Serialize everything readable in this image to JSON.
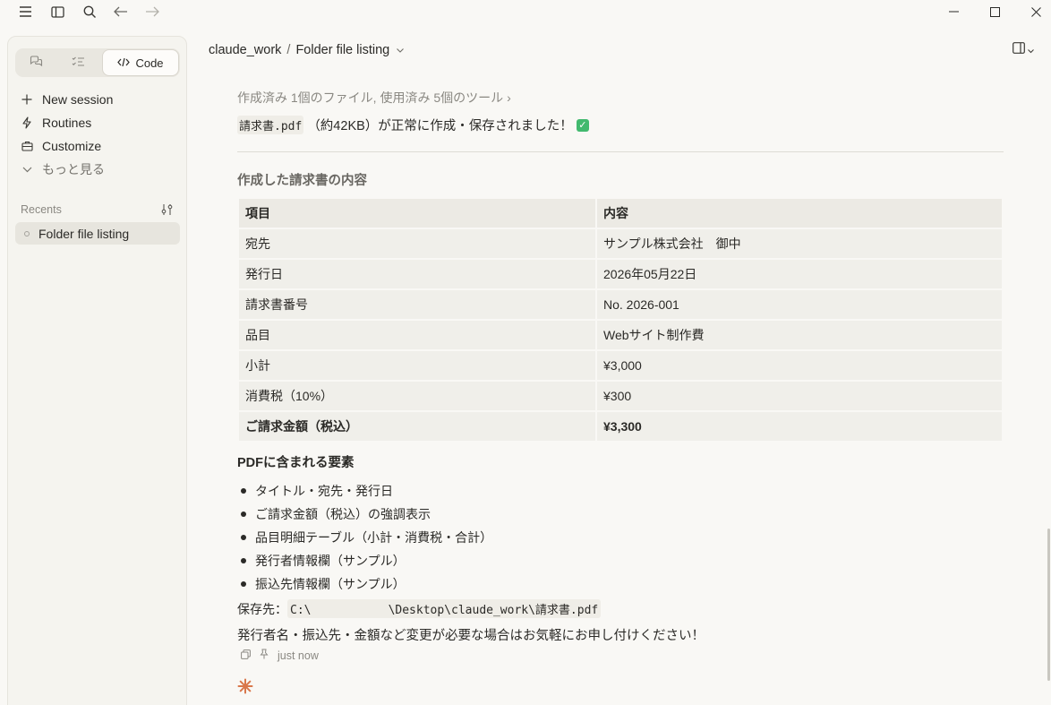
{
  "sidebar": {
    "mode_code_label": "Code",
    "nav": [
      {
        "label": "New session",
        "icon": "plus-icon"
      },
      {
        "label": "Routines",
        "icon": "bolt-icon"
      },
      {
        "label": "Customize",
        "icon": "briefcase-icon"
      },
      {
        "label": "もっと見る",
        "icon": "chevron-down-icon"
      }
    ],
    "recents_label": "Recents",
    "recent_items": [
      {
        "label": "Folder file listing"
      }
    ]
  },
  "header": {
    "project": "claude_work",
    "separator": "/",
    "session": "Folder file listing"
  },
  "message": {
    "tools_summary": "作成済み 1個のファイル, 使用済み 5個のツール",
    "tools_chevron": "›",
    "success_file": "請求書.pdf",
    "success_text": "（約42KB）が正常に作成・保存されました！",
    "check_mark": "✓",
    "section_title": "作成した請求書の内容",
    "table": {
      "headers": [
        "項目",
        "内容"
      ],
      "rows": [
        [
          "宛先",
          "サンプル株式会社　御中"
        ],
        [
          "発行日",
          "2026年05月22日"
        ],
        [
          "請求書番号",
          "No. 2026-001"
        ],
        [
          "品目",
          "Webサイト制作費"
        ],
        [
          "小計",
          "¥3,000"
        ],
        [
          "消費税（10%）",
          "¥300"
        ],
        [
          "ご請求金額（税込）",
          "¥3,300"
        ]
      ]
    },
    "pdf_elements_title": "PDFに含まれる要素",
    "pdf_elements": [
      "タイトル・宛先・発行日",
      "ご請求金額（税込）の強調表示",
      "品目明細テーブル（小計・消費税・合計）",
      "発行者情報欄（サンプル）",
      "振込先情報欄（サンプル）"
    ],
    "save_label": "保存先：",
    "save_path": "C:\\           \\Desktop\\claude_work\\請求書.pdf",
    "closing_note": "発行者名・振込先・金額など変更が必要な場合はお気軽にお申し付けください！",
    "timestamp": "just now"
  },
  "colors": {
    "background": "#f9f8f5",
    "sidebar": "#f5f4ef",
    "accent_spark": "#d9774b",
    "check_green": "#42b96e"
  }
}
